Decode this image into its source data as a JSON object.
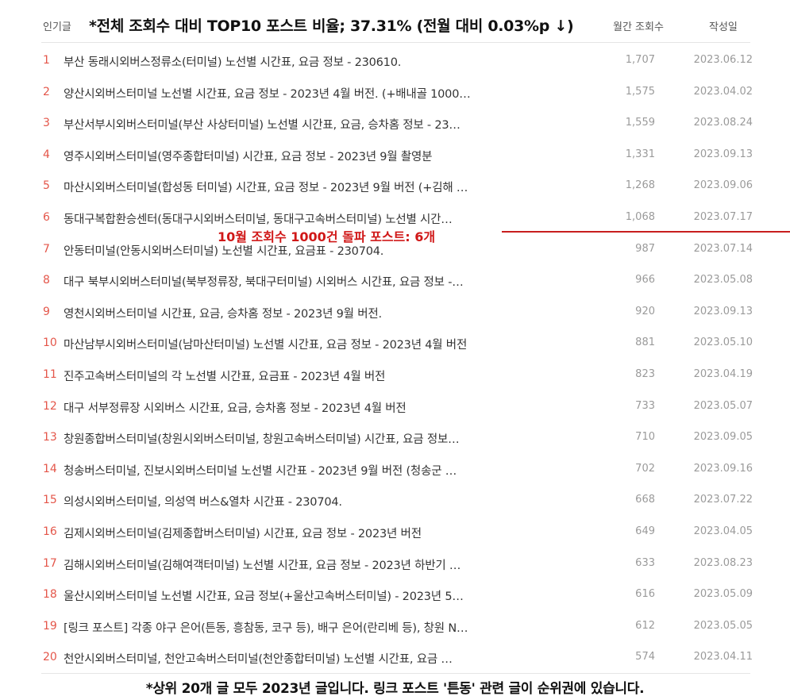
{
  "header": {
    "label": "인기글",
    "note": "*전체 조회수 대비 TOP10 포스트 비율; 37.31% (전월 대비 0.03%p ↓)",
    "views_col": "월간 조회수",
    "date_col": "작성일"
  },
  "rows": [
    {
      "rank": "1",
      "title": "부산 동래시외버스정류소(터미널) 노선별 시간표, 요금 정보 - 230610.",
      "views": "1,707",
      "date": "2023.06.12"
    },
    {
      "rank": "2",
      "title": "양산시외버스터미널 노선별 시간표, 요금 정보 - 2023년 4월 버전. (+배내골 1000…",
      "views": "1,575",
      "date": "2023.04.02"
    },
    {
      "rank": "3",
      "title": "부산서부시외버스터미널(부산 사상터미널) 노선별 시간표, 요금, 승차홈 정보 - 23…",
      "views": "1,559",
      "date": "2023.08.24"
    },
    {
      "rank": "4",
      "title": "영주시외버스터미널(영주종합터미널) 시간표, 요금 정보 - 2023년 9월 촬영분",
      "views": "1,331",
      "date": "2023.09.13"
    },
    {
      "rank": "5",
      "title": "마산시외버스터미널(합성동 터미널) 시간표, 요금 정보 - 2023년 9월 버전 (+김해 …",
      "views": "1,268",
      "date": "2023.09.06"
    },
    {
      "rank": "6",
      "title": "동대구복합환승센터(동대구시외버스터미널, 동대구고속버스터미널) 노선별 시간…",
      "views": "1,068",
      "date": "2023.07.17"
    },
    {
      "rank": "7",
      "title": "안동터미널(안동시외버스터미널) 노선별 시간표, 요금표 - 230704.",
      "views": "987",
      "date": "2023.07.14"
    },
    {
      "rank": "8",
      "title": "대구 북부시외버스터미널(북부정류장, 북대구터미널) 시외버스 시간표, 요금 정보 -…",
      "views": "966",
      "date": "2023.05.08"
    },
    {
      "rank": "9",
      "title": "영천시외버스터미널 시간표, 요금, 승차홈 정보 - 2023년 9월 버전.",
      "views": "920",
      "date": "2023.09.13"
    },
    {
      "rank": "10",
      "title": "마산남부시외버스터미널(남마산터미널) 노선별 시간표, 요금 정보 - 2023년 4월 버전",
      "views": "881",
      "date": "2023.05.10"
    },
    {
      "rank": "11",
      "title": "진주고속버스터미널의 각 노선별 시간표, 요금표 - 2023년 4월 버전",
      "views": "823",
      "date": "2023.04.19"
    },
    {
      "rank": "12",
      "title": "대구 서부정류장 시외버스 시간표, 요금, 승차홈 정보 - 2023년 4월 버전",
      "views": "733",
      "date": "2023.05.07"
    },
    {
      "rank": "13",
      "title": "창원종합버스터미널(창원시외버스터미널, 창원고속버스터미널) 시간표, 요금 정보…",
      "views": "710",
      "date": "2023.09.05"
    },
    {
      "rank": "14",
      "title": "청송버스터미널, 진보시외버스터미널 노선별 시간표 - 2023년 9월 버전 (청송군 …",
      "views": "702",
      "date": "2023.09.16"
    },
    {
      "rank": "15",
      "title": "의성시외버스터미널, 의성역 버스&열차 시간표 - 230704.",
      "views": "668",
      "date": "2023.07.22"
    },
    {
      "rank": "16",
      "title": "김제시외버스터미널(김제종합버스터미널) 시간표, 요금 정보 - 2023년 버전",
      "views": "649",
      "date": "2023.04.05"
    },
    {
      "rank": "17",
      "title": "김해시외버스터미널(김해여객터미널) 노선별 시간표, 요금 정보 - 2023년 하반기 …",
      "views": "633",
      "date": "2023.08.23"
    },
    {
      "rank": "18",
      "title": "울산시외버스터미널 노선별 시간표, 요금 정보(+울산고속버스터미널) - 2023년 5…",
      "views": "616",
      "date": "2023.05.09"
    },
    {
      "rank": "19",
      "title": "[링크 포스트] 각종 야구 은어(튼동, 흥참동, 코구 등), 배구 은어(란리베 등), 창원 N…",
      "views": "612",
      "date": "2023.05.05"
    },
    {
      "rank": "20",
      "title": "천안시외버스터미널, 천안고속버스터미널(천안종합터미널) 노선별 시간표, 요금 …",
      "views": "574",
      "date": "2023.04.11"
    }
  ],
  "annotation": {
    "text": "10월 조회수 1000건 돌파 포스트: 6개",
    "color": "#d01818"
  },
  "footer": {
    "note": "*상위 20개 글 모두 2023년 글입니다. 링크 포스트 '튼동' 관련 글이 순위권에 있습니다."
  },
  "colors": {
    "rank": "#e4564a",
    "meta": "#9a9a9a",
    "title": "#333333"
  }
}
